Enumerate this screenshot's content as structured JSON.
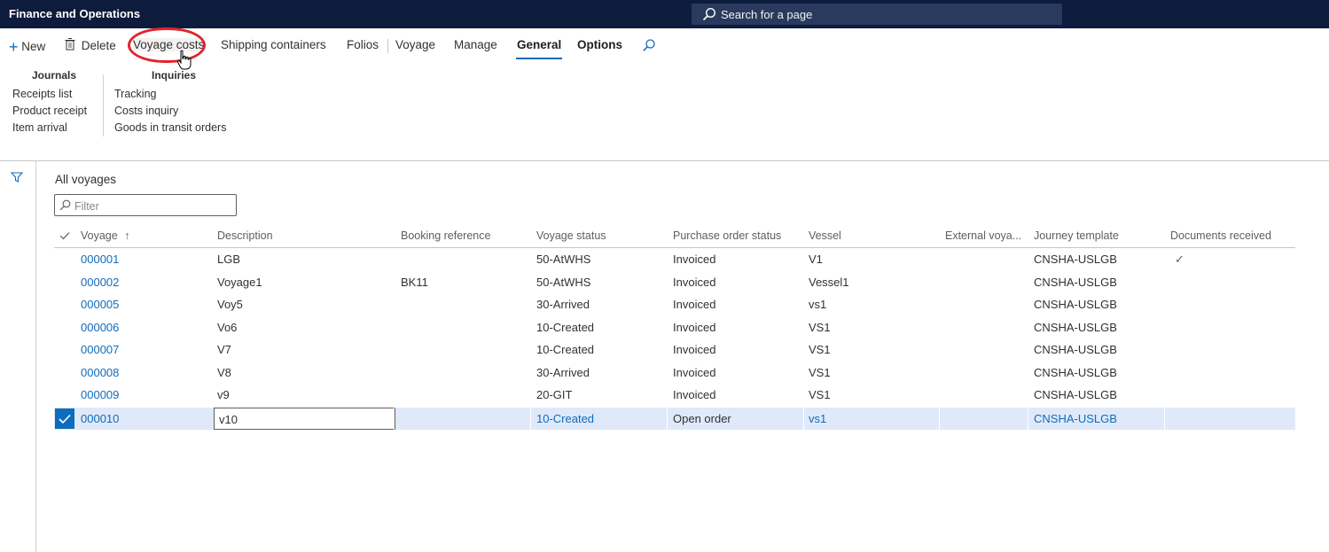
{
  "app": {
    "title": "Finance and Operations"
  },
  "search": {
    "placeholder": "Search for a page"
  },
  "actions": {
    "new": "New",
    "delete": "Delete",
    "voyage_costs": "Voyage costs",
    "shipping_containers": "Shipping containers",
    "folios": "Folios",
    "voyage": "Voyage",
    "manage": "Manage",
    "general": "General",
    "options": "Options"
  },
  "ribbon": {
    "journals": {
      "title": "Journals",
      "items": [
        "Receipts list",
        "Product receipt",
        "Item arrival"
      ]
    },
    "inquiries": {
      "title": "Inquiries",
      "items": [
        "Tracking",
        "Costs inquiry",
        "Goods in transit orders"
      ]
    }
  },
  "grid": {
    "title": "All voyages",
    "filter_placeholder": "Filter",
    "columns": [
      "Voyage",
      "Description",
      "Booking reference",
      "Voyage status",
      "Purchase order status",
      "Vessel",
      "External voya...",
      "Journey template",
      "Documents received"
    ],
    "sort_indicator": "↑",
    "rows": [
      {
        "voyage": "000001",
        "description": "LGB",
        "booking": "",
        "status": "50-AtWHS",
        "po_status": "Invoiced",
        "vessel": "V1",
        "external": "",
        "template": "CNSHA-USLGB",
        "docs": "✓"
      },
      {
        "voyage": "000002",
        "description": "Voyage1",
        "booking": "BK11",
        "status": "50-AtWHS",
        "po_status": "Invoiced",
        "vessel": "Vessel1",
        "external": "",
        "template": "CNSHA-USLGB",
        "docs": ""
      },
      {
        "voyage": "000005",
        "description": "Voy5",
        "booking": "",
        "status": "30-Arrived",
        "po_status": "Invoiced",
        "vessel": "vs1",
        "external": "",
        "template": "CNSHA-USLGB",
        "docs": ""
      },
      {
        "voyage": "000006",
        "description": "Vo6",
        "booking": "",
        "status": "10-Created",
        "po_status": "Invoiced",
        "vessel": "VS1",
        "external": "",
        "template": "CNSHA-USLGB",
        "docs": ""
      },
      {
        "voyage": "000007",
        "description": "V7",
        "booking": "",
        "status": "10-Created",
        "po_status": "Invoiced",
        "vessel": "VS1",
        "external": "",
        "template": "CNSHA-USLGB",
        "docs": ""
      },
      {
        "voyage": "000008",
        "description": "V8",
        "booking": "",
        "status": "30-Arrived",
        "po_status": "Invoiced",
        "vessel": "VS1",
        "external": "",
        "template": "CNSHA-USLGB",
        "docs": ""
      },
      {
        "voyage": "000009",
        "description": "v9",
        "booking": "",
        "status": "20-GIT",
        "po_status": "Invoiced",
        "vessel": "VS1",
        "external": "",
        "template": "CNSHA-USLGB",
        "docs": ""
      },
      {
        "voyage": "000010",
        "description": "v10",
        "booking": "",
        "status": "10-Created",
        "po_status": "Open order",
        "vessel": "vs1",
        "external": "",
        "template": "CNSHA-USLGB",
        "docs": ""
      }
    ]
  },
  "colors": {
    "topbar": "#0d1b3d",
    "accent": "#0f6cbd",
    "selected_row": "#dfe9f9",
    "highlight": "#e0242a"
  }
}
